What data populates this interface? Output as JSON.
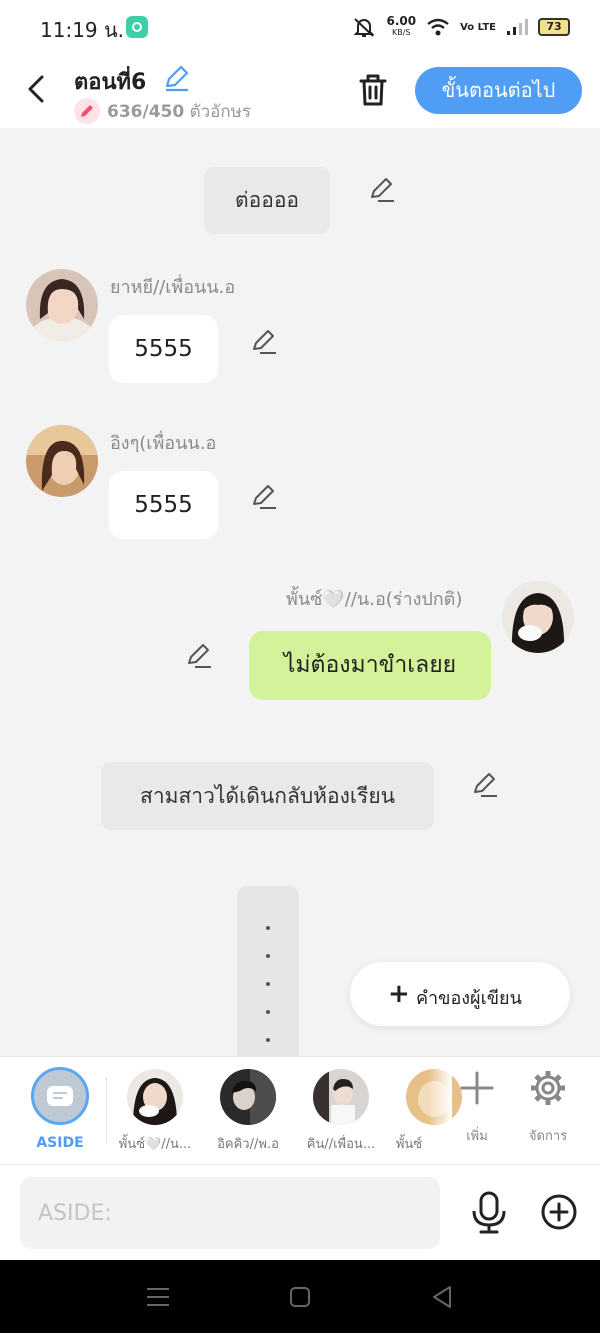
{
  "status_bar": {
    "time": "11:19 น.",
    "net_speed": "6.00",
    "net_unit": "KB/S",
    "volte": "Vo LTE",
    "battery": "73"
  },
  "header": {
    "title": "ตอนที่6",
    "char_count": "636/450",
    "char_unit": "ตัวอักษร",
    "next_label": "ขั้นตอนต่อไป"
  },
  "messages": {
    "narration1": "ต่ออออ",
    "char1_name": "ยาหยี//เพื่อนน.อ",
    "char1_text": "5555",
    "char2_name": "อิงๆ(เพื่อนน.อ",
    "char2_text": "5555",
    "char3_name": "พั้นซ์🤍//น.อ(ร่างปกติ)",
    "char3_text": "ไม่ต้องมาขำเลยย",
    "narration2": "สามสาวได้เดินกลับห้องเรียน"
  },
  "author_note_label": "คำของผู้เขียน",
  "char_bar": {
    "aside_label": "ASIDE",
    "characters": [
      {
        "name": "พั้นซ์🤍//น..."
      },
      {
        "name": "อิคคิว//พ.อ"
      },
      {
        "name": "คิน//เพื่อน..."
      },
      {
        "name": "พั้นซ์"
      }
    ],
    "add_label": "เพิ่ม",
    "manage_label": "จัดการ"
  },
  "input": {
    "placeholder": "ASIDE:"
  },
  "colors": {
    "accent": "#4f9df5",
    "my_bubble": "#d3f29a",
    "narration_bg": "#e9e9e9"
  }
}
